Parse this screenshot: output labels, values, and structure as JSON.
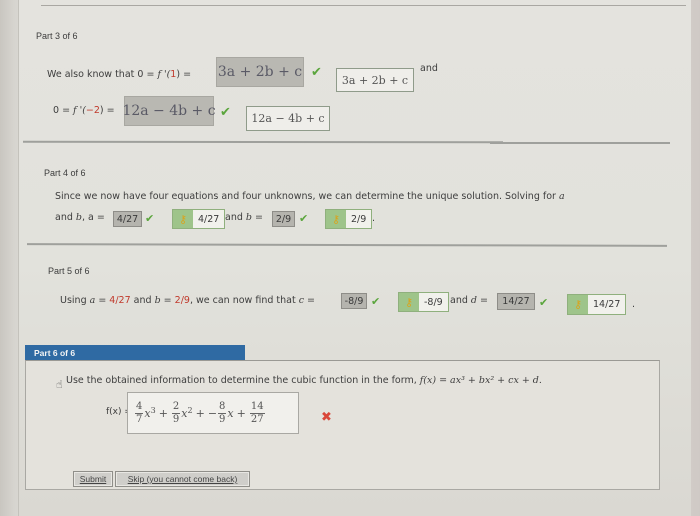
{
  "part3": {
    "label": "Part 3 of 6",
    "line1_prefix": "We also know that  0 = ",
    "line1_func": "f '(",
    "line1_arg": "1",
    "line1_close": ") = ",
    "line1_answer": "3a + 2b + c",
    "line1_correct": "3a + 2b + c",
    "and_text": "and",
    "line2_prefix": "0 = ",
    "line2_func": "f '(",
    "line2_arg": "−2",
    "line2_close": ") = ",
    "line2_answer": "12a − 4b + c",
    "line2_correct": "12a − 4b + c"
  },
  "part4": {
    "label": "Part 4 of 6",
    "sentence": "Since we now have four equations and four unknowns, we can determine the unique solution. Solving for",
    "var_a_end": "a",
    "and_b": "and ",
    "b_var": "b",
    "a_eq": ", a = ",
    "a_answer": "4/27",
    "a_correct": "4/27",
    "and_b_eq": " and ",
    "b_eq": "b = ",
    "b_answer": "2/9",
    "b_correct": "2/9",
    "period": "."
  },
  "part5": {
    "label": "Part 5 of 6",
    "using": "Using ",
    "a_var": "a",
    "eq": " = ",
    "a_val": "4/27",
    "and_text": " and ",
    "b_var": "b",
    "b_val": "2/9",
    "rest": ", we can now find that ",
    "c_var": "c",
    "c_answer": "-8/9",
    "c_correct": "-8/9",
    "and_d": "and ",
    "d_var": "d",
    "d_answer": "14/27",
    "d_correct": "14/27",
    "period": "."
  },
  "part6": {
    "label": "Part 6 of 6",
    "instruction": "Use the obtained information to determine the cubic function in the form, ",
    "form": "f(x) = ax³ + bx² + cx + d.",
    "fx_label": "f(x) = ",
    "answer": {
      "t1_num": "4",
      "t1_den": "7",
      "t1_var": "x",
      "t1_exp": "3",
      "t2_num": "2",
      "t2_den": "9",
      "t2_var": "x",
      "t2_exp": "2",
      "t3_prefix": "−",
      "t3_num": "8",
      "t3_den": "9",
      "t3_var": "x",
      "t4_num": "14",
      "t4_den": "27",
      "plus": "+"
    },
    "status": "incorrect",
    "x_mark": "✖"
  },
  "buttons": {
    "submit": "Submit",
    "skip": "Skip (you cannot come back)"
  },
  "icons": {
    "check": "✔",
    "key": "🔑"
  },
  "colors": {
    "header_blue": "#2f6aa3",
    "check_green": "#5aa53c",
    "x_red": "#d9473a",
    "value_red": "#c0392b"
  }
}
